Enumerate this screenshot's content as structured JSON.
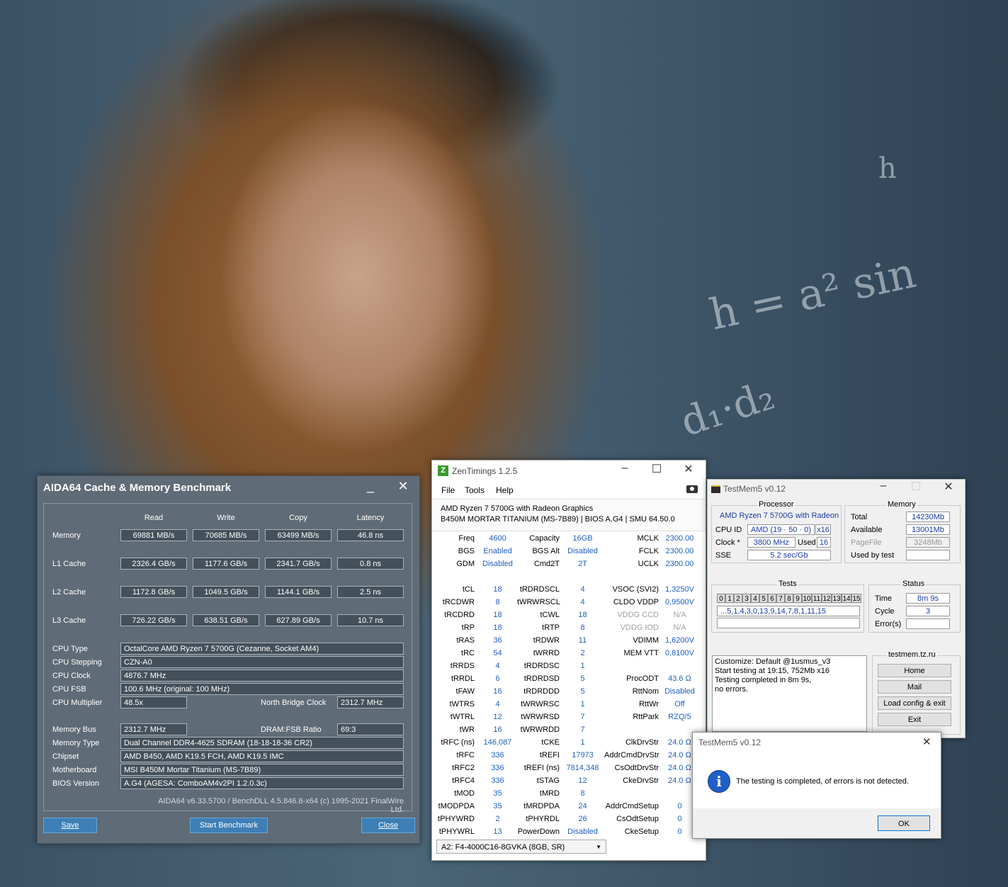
{
  "aida": {
    "title": "AIDA64 Cache & Memory Benchmark",
    "minimize": "_",
    "close_x": "✕",
    "headers": [
      "Read",
      "Write",
      "Copy",
      "Latency"
    ],
    "rows": [
      {
        "label": "Memory",
        "read": "69881 MB/s",
        "write": "70685 MB/s",
        "copy": "63499 MB/s",
        "latency": "46.8 ns"
      },
      {
        "label": "L1 Cache",
        "read": "2326.4 GB/s",
        "write": "1177.6 GB/s",
        "copy": "2341.7 GB/s",
        "latency": "0.8 ns"
      },
      {
        "label": "L2 Cache",
        "read": "1172.8 GB/s",
        "write": "1049.5 GB/s",
        "copy": "1144.1 GB/s",
        "latency": "2.5 ns"
      },
      {
        "label": "L3 Cache",
        "read": "726.22 GB/s",
        "write": "638.51 GB/s",
        "copy": "627.89 GB/s",
        "latency": "10.7 ns"
      }
    ],
    "cpu_type_label": "CPU Type",
    "cpu_type": "OctalCore AMD Ryzen 7 5700G  (Cezanne, Socket AM4)",
    "cpu_stepping_label": "CPU Stepping",
    "cpu_stepping": "CZN-A0",
    "cpu_clock_label": "CPU Clock",
    "cpu_clock": "4876.7 MHz",
    "cpu_fsb_label": "CPU FSB",
    "cpu_fsb": "100.6 MHz  (original: 100 MHz)",
    "cpu_mult_label": "CPU Multiplier",
    "cpu_mult": "48.5x",
    "nb_clock_label": "North Bridge Clock",
    "nb_clock": "2312.7 MHz",
    "mem_bus_label": "Memory Bus",
    "mem_bus": "2312.7 MHz",
    "dram_fsb_label": "DRAM:FSB Ratio",
    "dram_fsb": "69:3",
    "mem_type_label": "Memory Type",
    "mem_type": "Dual Channel DDR4-4625 SDRAM  (18-18-18-36 CR2)",
    "chipset_label": "Chipset",
    "chipset": "AMD B450, AMD K19.5 FCH, AMD K19.5 IMC",
    "mobo_label": "Motherboard",
    "mobo": "MSI B450M Mortar Titanium (MS-7B89)",
    "bios_label": "BIOS Version",
    "bios": "A.G4  (AGESA: ComboAM4v2PI 1.2.0.3c)",
    "footer": "AIDA64 v6.33.5700 / BenchDLL 4.5.846.8-x64  (c) 1995-2021 FinalWire Ltd.",
    "save": "Save",
    "start": "Start Benchmark",
    "close": "Close"
  },
  "zen": {
    "title": "ZenTimings 1.2.5",
    "menu": [
      "File",
      "Tools",
      "Help"
    ],
    "cpu": "AMD Ryzen 7 5700G with Radeon Graphics",
    "board": "B450M MORTAR TITANIUM (MS-7B89) | BIOS A.G4 | SMU 64.50.0",
    "col1": [
      [
        "Freq",
        "4600"
      ],
      [
        "BGS",
        "Enabled"
      ],
      [
        "GDM",
        "Disabled"
      ],
      [
        "",
        ""
      ],
      [
        "tCL",
        "18"
      ],
      [
        "tRCDWR",
        "8"
      ],
      [
        "tRCDRD",
        "18"
      ],
      [
        "tRP",
        "18"
      ],
      [
        "tRAS",
        "36"
      ],
      [
        "tRC",
        "54"
      ],
      [
        "tRRDS",
        "4"
      ],
      [
        "tRRDL",
        "6"
      ],
      [
        "tFAW",
        "16"
      ],
      [
        "tWTRS",
        "4"
      ],
      [
        "tWTRL",
        "12"
      ],
      [
        "tWR",
        "16"
      ],
      [
        "tRFC (ns)",
        "146,087"
      ],
      [
        "tRFC",
        "336"
      ],
      [
        "tRFC2",
        "336"
      ],
      [
        "tRFC4",
        "336"
      ],
      [
        "tMOD",
        "35"
      ],
      [
        "tMODPDA",
        "35"
      ],
      [
        "tPHYWRD",
        "2"
      ],
      [
        "tPHYWRL",
        "13"
      ]
    ],
    "col2": [
      [
        "Capacity",
        "16GB"
      ],
      [
        "BGS Alt",
        "Disabled"
      ],
      [
        "Cmd2T",
        "2T"
      ],
      [
        "",
        ""
      ],
      [
        "tRDRDSCL",
        "4"
      ],
      [
        "tWRWRSCL",
        "4"
      ],
      [
        "tCWL",
        "18"
      ],
      [
        "tRTP",
        "8"
      ],
      [
        "tRDWR",
        "11"
      ],
      [
        "tWRRD",
        "2"
      ],
      [
        "tRDRDSC",
        "1"
      ],
      [
        "tRDRDSD",
        "5"
      ],
      [
        "tRDRDDD",
        "5"
      ],
      [
        "tWRWRSC",
        "1"
      ],
      [
        "tWRWRSD",
        "7"
      ],
      [
        "tWRWRDD",
        "7"
      ],
      [
        "tCKE",
        "1"
      ],
      [
        "tREFI",
        "17973"
      ],
      [
        "tREFI (ns)",
        "7814,348"
      ],
      [
        "tSTAG",
        "12"
      ],
      [
        "tMRD",
        "8"
      ],
      [
        "tMRDPDA",
        "24"
      ],
      [
        "tPHYRDL",
        "26"
      ],
      [
        "PowerDown",
        "Disabled"
      ]
    ],
    "col3": [
      [
        "MCLK",
        "2300.00"
      ],
      [
        "FCLK",
        "2300.00"
      ],
      [
        "UCLK",
        "2300.00"
      ],
      [
        "",
        ""
      ],
      [
        "VSOC (SVI2)",
        "1,3250V"
      ],
      [
        "CLDO VDDP",
        "0,9500V"
      ],
      [
        "VDDG CCD",
        "N/A"
      ],
      [
        "VDDG IOD",
        "N/A"
      ],
      [
        "VDIMM",
        "1,6200V"
      ],
      [
        "MEM VTT",
        "0,8100V"
      ],
      [
        "",
        ""
      ],
      [
        "ProcODT",
        "43.6 Ω"
      ],
      [
        "RttNom",
        "Disabled"
      ],
      [
        "RttWr",
        "Off"
      ],
      [
        "RttPark",
        "RZQ/5"
      ],
      [
        "",
        ""
      ],
      [
        "ClkDrvStr",
        "24.0 Ω"
      ],
      [
        "AddrCmdDrvStr",
        "24.0 Ω"
      ],
      [
        "CsOdtDrvStr",
        "24.0 Ω"
      ],
      [
        "CkeDrvStr",
        "24.0 Ω"
      ],
      [
        "",
        ""
      ],
      [
        "AddrCmdSetup",
        "0"
      ],
      [
        "CsOdtSetup",
        "0"
      ],
      [
        "CkeSetup",
        "0"
      ]
    ],
    "dimm": "A2: F4-4000C16-8GVKA (8GB, SR)"
  },
  "testmem": {
    "title": "TestMem5 v0.12",
    "processor_label": "Processor",
    "cpu_name": "AMD Ryzen 7 5700G with Radeon",
    "cpu_id_label": "CPU ID",
    "cpu_id": "AMD  (19 · 50 · 0)",
    "threads": "x16",
    "clock_label": "Clock *",
    "clock": "3800 MHz",
    "used_label": "Used",
    "used": "16",
    "sse_label": "SSE",
    "sse": "5.2 sec/Gb",
    "memory_label": "Memory",
    "total_label": "Total",
    "total": "14230Mb",
    "avail_label": "Available",
    "avail": "13001Mb",
    "pagefile_label": "PageFile",
    "pagefile": "3248Mb",
    "usedby_label": "Used by test",
    "usedby": "",
    "tests_label": "Tests",
    "test_cells": [
      "0",
      "1",
      "2",
      "3",
      "4",
      "5",
      "6",
      "7",
      "8",
      "9",
      "10",
      "11",
      "12",
      "13",
      "14",
      "15"
    ],
    "test_seq": "...5,1,4,3,0,13,9,14,7,8,1,11,15",
    "status_label": "Status",
    "time_label": "Time",
    "time": "8m 9s",
    "cycle_label": "Cycle",
    "cycle": "3",
    "errors_label": "Error(s)",
    "errors": "",
    "log": [
      "Customize: Default @1usmus_v3",
      "Start testing at 19:15, 752Mb x16",
      "Testing completed in 8m 9s,",
      "no errors."
    ],
    "site_label": "testmem.tz.ru",
    "btn_home": "Home",
    "btn_mail": "Mail",
    "btn_load": "Load config & exit",
    "btn_exit": "Exit"
  },
  "dialog": {
    "title": "TestMem5 v0.12",
    "message": "The testing is completed, of errors is not detected.",
    "ok": "OK"
  }
}
